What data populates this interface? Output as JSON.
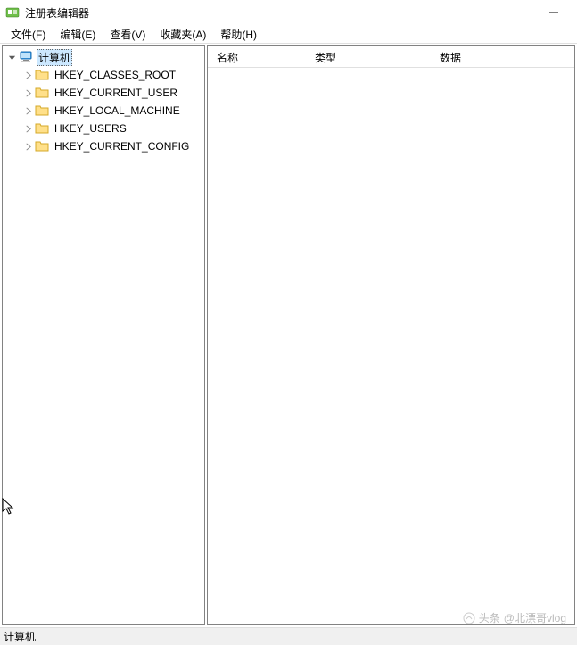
{
  "window": {
    "title": "注册表编辑器"
  },
  "menu": {
    "file": "文件(F)",
    "edit": "编辑(E)",
    "view": "查看(V)",
    "favorites": "收藏夹(A)",
    "help": "帮助(H)"
  },
  "tree": {
    "root": "计算机",
    "keys": [
      "HKEY_CLASSES_ROOT",
      "HKEY_CURRENT_USER",
      "HKEY_LOCAL_MACHINE",
      "HKEY_USERS",
      "HKEY_CURRENT_CONFIG"
    ]
  },
  "columns": {
    "name": "名称",
    "type": "类型",
    "data": "数据"
  },
  "statusbar": {
    "path": "计算机"
  },
  "watermark": {
    "prefix": "头条",
    "author": "@北漂哥vlog"
  }
}
